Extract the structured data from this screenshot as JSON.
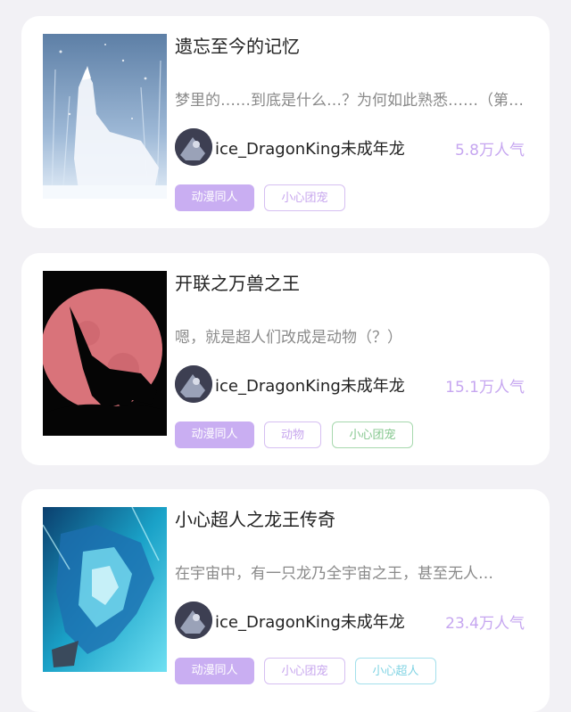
{
  "colors": {
    "background": "#f2f1f5",
    "card": "#ffffff",
    "title_text": "#222222",
    "description_text": "#8a8a8a",
    "popularity_text": "#c6a6f0",
    "tag_filled_bg": "#c9aef2",
    "tag_purple": "#c7a6ee",
    "tag_green": "#84c78e",
    "tag_cyan": "#7fd3e3"
  },
  "stories": [
    {
      "title": "遗忘至今的记忆",
      "description": "梦里的……到底是什么…？为何如此熟悉……（第…",
      "author": "ice_DragonKing未成年龙",
      "popularity": "5.8万人气",
      "cover_icon": "white-wolf-howling-snow",
      "tags": [
        {
          "label": "动漫同人",
          "style": "filled"
        },
        {
          "label": "小心团宠",
          "style": "outline-purple"
        }
      ]
    },
    {
      "title": "开联之万兽之王",
      "description": "嗯，就是超人们改成是动物（？）",
      "author": "ice_DragonKing未成年龙",
      "popularity": "15.1万人气",
      "cover_icon": "wolf-silhouette-red-moon",
      "tags": [
        {
          "label": "动漫同人",
          "style": "filled"
        },
        {
          "label": "动物",
          "style": "outline-purple"
        },
        {
          "label": "小心团宠",
          "style": "outline-green"
        }
      ]
    },
    {
      "title": "小心超人之龙王传奇",
      "description": "在宇宙中，有一只龙乃全宇宙之王，甚至无人…",
      "author": "ice_DragonKing未成年龙",
      "popularity": "23.4万人气",
      "cover_icon": "ice-dragon",
      "tags": [
        {
          "label": "动漫同人",
          "style": "filled"
        },
        {
          "label": "小心团宠",
          "style": "outline-purple"
        },
        {
          "label": "小心超人",
          "style": "outline-cyan"
        }
      ]
    }
  ]
}
